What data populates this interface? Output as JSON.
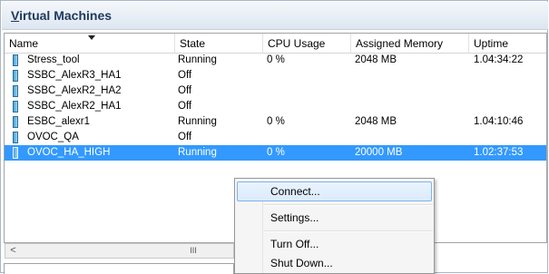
{
  "panel": {
    "title_prefix": "V",
    "title_rest": "irtual Machines"
  },
  "columns": [
    "Name",
    "State",
    "CPU Usage",
    "Assigned Memory",
    "Uptime"
  ],
  "rows": [
    {
      "name": "Stress_tool",
      "state": "Running",
      "cpu": "0 %",
      "memory": "2048 MB",
      "uptime": "1.04:34:22"
    },
    {
      "name": "SSBC_AlexR3_HA1",
      "state": "Off",
      "cpu": "",
      "memory": "",
      "uptime": ""
    },
    {
      "name": "SSBC_AlexR2_HA2",
      "state": "Off",
      "cpu": "",
      "memory": "",
      "uptime": ""
    },
    {
      "name": "SSBC_AlexR2_HA1",
      "state": "Off",
      "cpu": "",
      "memory": "",
      "uptime": ""
    },
    {
      "name": "ESBC_alexr1",
      "state": "Running",
      "cpu": "0 %",
      "memory": "2048 MB",
      "uptime": "1.04:10:46"
    },
    {
      "name": "OVOC_QA",
      "state": "Off",
      "cpu": "",
      "memory": "",
      "uptime": ""
    },
    {
      "name": "OVOC_HA_HIGH",
      "state": "Running",
      "cpu": "0 %",
      "memory": "20000 MB",
      "uptime": "1.02:37:53"
    }
  ],
  "scrollbar": {
    "left_arrow": "<",
    "thumb": "III"
  },
  "context_menu": {
    "items": [
      "Connect...",
      "Settings...",
      "Turn Off...",
      "Shut Down..."
    ]
  },
  "colors": {
    "selection": "#3399ff",
    "title": "#1e395b",
    "menu_hover_border": "#7eb4ea"
  }
}
